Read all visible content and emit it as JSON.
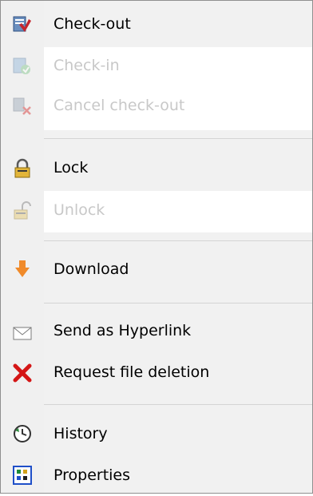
{
  "menu": {
    "items": [
      {
        "label": "Check-out",
        "icon": "check-out-icon",
        "enabled": true
      },
      {
        "label": "Check-in",
        "icon": "check-in-icon",
        "enabled": false
      },
      {
        "label": "Cancel check-out",
        "icon": "cancel-check-out-icon",
        "enabled": false
      },
      {
        "label": "Lock",
        "icon": "lock-icon",
        "enabled": true
      },
      {
        "label": "Unlock",
        "icon": "unlock-icon",
        "enabled": false
      },
      {
        "label": "Download",
        "icon": "download-arrow-icon",
        "enabled": true
      },
      {
        "label": "Send as Hyperlink",
        "icon": "envelope-icon",
        "enabled": true
      },
      {
        "label": "Request file deletion",
        "icon": "red-x-icon",
        "enabled": true
      },
      {
        "label": "History",
        "icon": "history-clock-icon",
        "enabled": true
      },
      {
        "label": "Properties",
        "icon": "properties-grid-icon",
        "enabled": true
      }
    ]
  },
  "colors": {
    "disabled_text": "#c8c8c8",
    "separator": "#d4d4d4",
    "border": "#8f8f8f"
  }
}
